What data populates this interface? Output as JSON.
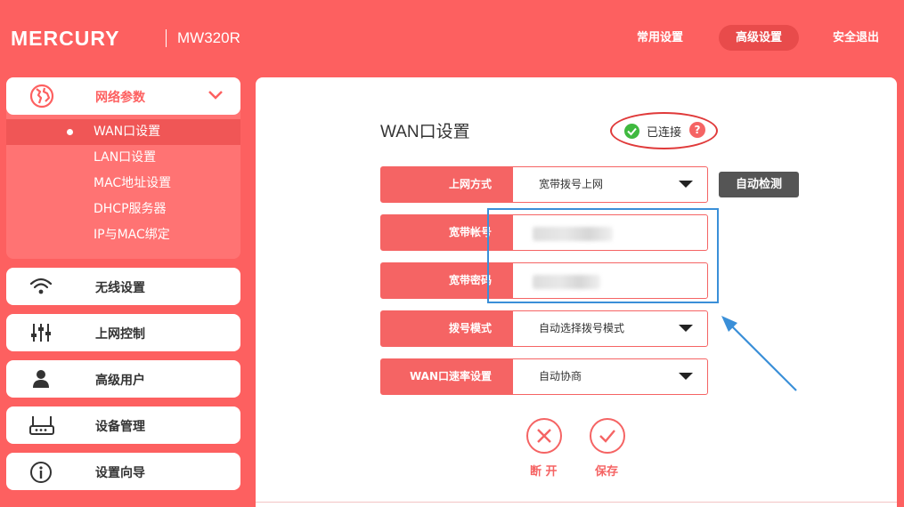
{
  "header": {
    "brand": "MERCURY",
    "model": "MW320R",
    "nav": [
      {
        "label": "常用设置",
        "active": false
      },
      {
        "label": "高级设置",
        "active": true
      },
      {
        "label": "安全退出",
        "active": false
      }
    ]
  },
  "sidebar": {
    "expanded_section": {
      "label": "网络参数",
      "icon": "globe-icon",
      "items": [
        {
          "label": "WAN口设置",
          "active": true
        },
        {
          "label": "LAN口设置",
          "active": false
        },
        {
          "label": "MAC地址设置",
          "active": false
        },
        {
          "label": "DHCP服务器",
          "active": false
        },
        {
          "label": "IP与MAC绑定",
          "active": false
        }
      ]
    },
    "sections": [
      {
        "label": "无线设置",
        "icon": "wifi-icon"
      },
      {
        "label": "上网控制",
        "icon": "sliders-icon"
      },
      {
        "label": "高级用户",
        "icon": "user-icon"
      },
      {
        "label": "设备管理",
        "icon": "router-icon"
      },
      {
        "label": "设置向导",
        "icon": "info-icon"
      }
    ]
  },
  "main": {
    "title": "WAN口设置",
    "status": "已连接",
    "help": "?",
    "form": {
      "connection_type": {
        "label": "上网方式",
        "value": "宽带拨号上网"
      },
      "account": {
        "label": "宽带帐号"
      },
      "password": {
        "label": "宽带密码"
      },
      "dial_mode": {
        "label": "拨号模式",
        "value": "自动选择拨号模式"
      },
      "wan_speed": {
        "label": "WAN口速率设置",
        "value": "自动协商"
      }
    },
    "detect_button": "自动检测",
    "disconnect_button": "断 开",
    "save_button": "保存"
  },
  "colors": {
    "brand_red": "#fd6060",
    "accent_red": "#f56464",
    "annotation_blue": "#3a8fd8",
    "ok_green": "#3fb93f"
  }
}
